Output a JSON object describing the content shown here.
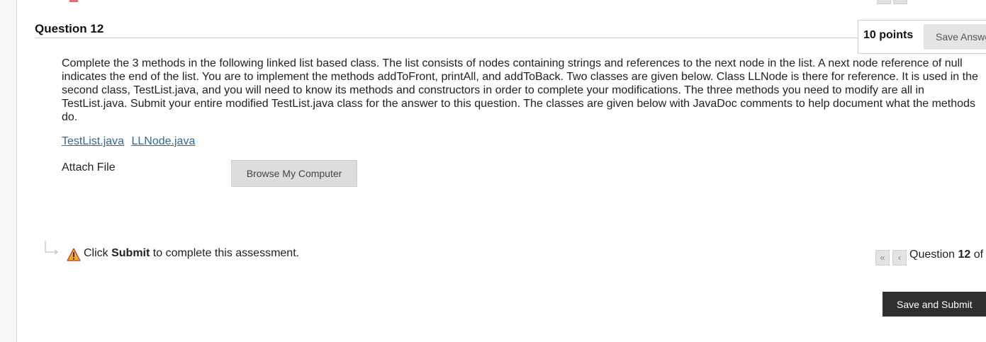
{
  "question": {
    "title": "Question 12",
    "points": "10 points",
    "save_answer_label": "Save Answer",
    "body": "Complete the 3 methods in the following linked list based class.  The list consists of nodes containing strings and references to the next node in the list.  A next node reference of null indicates the end of the list.  You are to implement the methods addToFront, printAll, and addToBack.   Two classes are given below.  Class LLNode is there for reference.  It is used in the second class, TestList.java, and you will need to know its methods and constructors in order to complete your modifications.   The three methods you need to modify are all in TestList.java.  Submit your entire modified TestList.java class for the answer to this question.  The classes are given below with JavaDoc comments to help document what the methods do.",
    "files": [
      "TestList.java",
      "LLNode.java"
    ],
    "attach_label": "Attach File",
    "browse_label": "Browse My Computer"
  },
  "footer": {
    "hint_prefix": "Click ",
    "hint_bold": "Submit",
    "hint_suffix": " to complete this assessment.",
    "first_icon": "«",
    "prev_icon": "‹",
    "counter_prefix": "Question ",
    "counter_number": "12",
    "counter_suffix": " of",
    "save_submit_label": "Save and Submit"
  },
  "icons": {
    "connector": "connector-arrow-icon",
    "warning": "warning-icon"
  },
  "colors": {
    "link": "#2d6a9f",
    "primary_button": "#2f2f2f",
    "warning": "#f5a623"
  }
}
